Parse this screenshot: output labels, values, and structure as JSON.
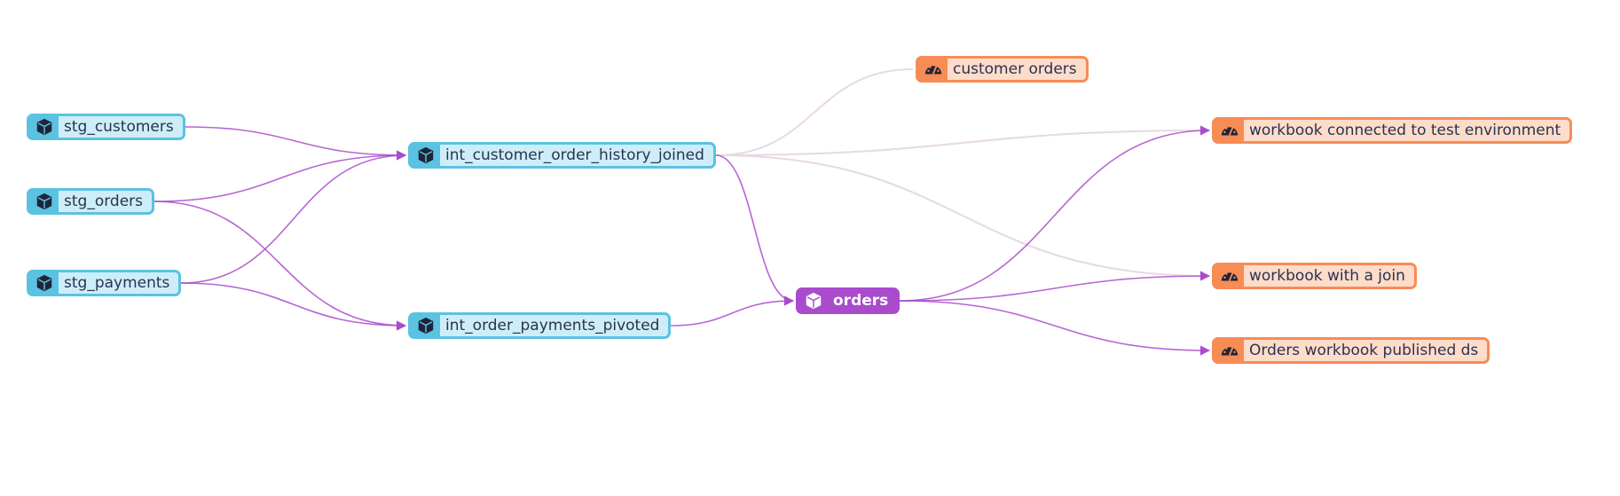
{
  "colors": {
    "model_border": "#5bc2e2",
    "model_fill": "#cdeef9",
    "exposure_border": "#f78c55",
    "exposure_fill": "#fddcca",
    "selected": "#a94bcc",
    "edge_active": "#a94bcc",
    "edge_faded": "#e8d8e4",
    "text": "#2b3250"
  },
  "nodes": [
    {
      "id": "stg_customers",
      "label": "stg_customers",
      "type": "model",
      "icon": "cube-icon"
    },
    {
      "id": "stg_orders",
      "label": "stg_orders",
      "type": "model",
      "icon": "cube-icon"
    },
    {
      "id": "stg_payments",
      "label": "stg_payments",
      "type": "model",
      "icon": "cube-icon"
    },
    {
      "id": "int_customer_order_history_joined",
      "label": "int_customer_order_history_joined",
      "type": "model",
      "icon": "cube-icon"
    },
    {
      "id": "int_order_payments_pivoted",
      "label": "int_order_payments_pivoted",
      "type": "model",
      "icon": "cube-icon"
    },
    {
      "id": "orders",
      "label": "orders",
      "type": "model",
      "selected": true,
      "icon": "cube-icon"
    },
    {
      "id": "customer_orders",
      "label": "customer orders",
      "type": "exposure",
      "icon": "dashboard-gauge-icon"
    },
    {
      "id": "workbook_connected_to_test_environment",
      "label": "workbook connected to test environment",
      "type": "exposure",
      "icon": "dashboard-gauge-icon"
    },
    {
      "id": "workbook_with_a_join",
      "label": "workbook with a join",
      "type": "exposure",
      "icon": "dashboard-gauge-icon"
    },
    {
      "id": "orders_workbook_published_ds",
      "label": "Orders workbook published ds",
      "type": "exposure",
      "icon": "dashboard-gauge-icon"
    }
  ],
  "edges": [
    {
      "from": "stg_customers",
      "to": "int_customer_order_history_joined",
      "highlighted": true
    },
    {
      "from": "stg_orders",
      "to": "int_customer_order_history_joined",
      "highlighted": true
    },
    {
      "from": "stg_payments",
      "to": "int_customer_order_history_joined",
      "highlighted": true
    },
    {
      "from": "stg_orders",
      "to": "int_order_payments_pivoted",
      "highlighted": true
    },
    {
      "from": "stg_payments",
      "to": "int_order_payments_pivoted",
      "highlighted": true
    },
    {
      "from": "int_customer_order_history_joined",
      "to": "orders",
      "highlighted": true
    },
    {
      "from": "int_order_payments_pivoted",
      "to": "orders",
      "highlighted": true
    },
    {
      "from": "int_customer_order_history_joined",
      "to": "customer_orders",
      "highlighted": false
    },
    {
      "from": "int_customer_order_history_joined",
      "to": "workbook_connected_to_test_environment",
      "highlighted": false
    },
    {
      "from": "int_customer_order_history_joined",
      "to": "workbook_with_a_join",
      "highlighted": false
    },
    {
      "from": "orders",
      "to": "workbook_connected_to_test_environment",
      "highlighted": true
    },
    {
      "from": "orders",
      "to": "workbook_with_a_join",
      "highlighted": true
    },
    {
      "from": "orders",
      "to": "orders_workbook_published_ds",
      "highlighted": true
    }
  ]
}
